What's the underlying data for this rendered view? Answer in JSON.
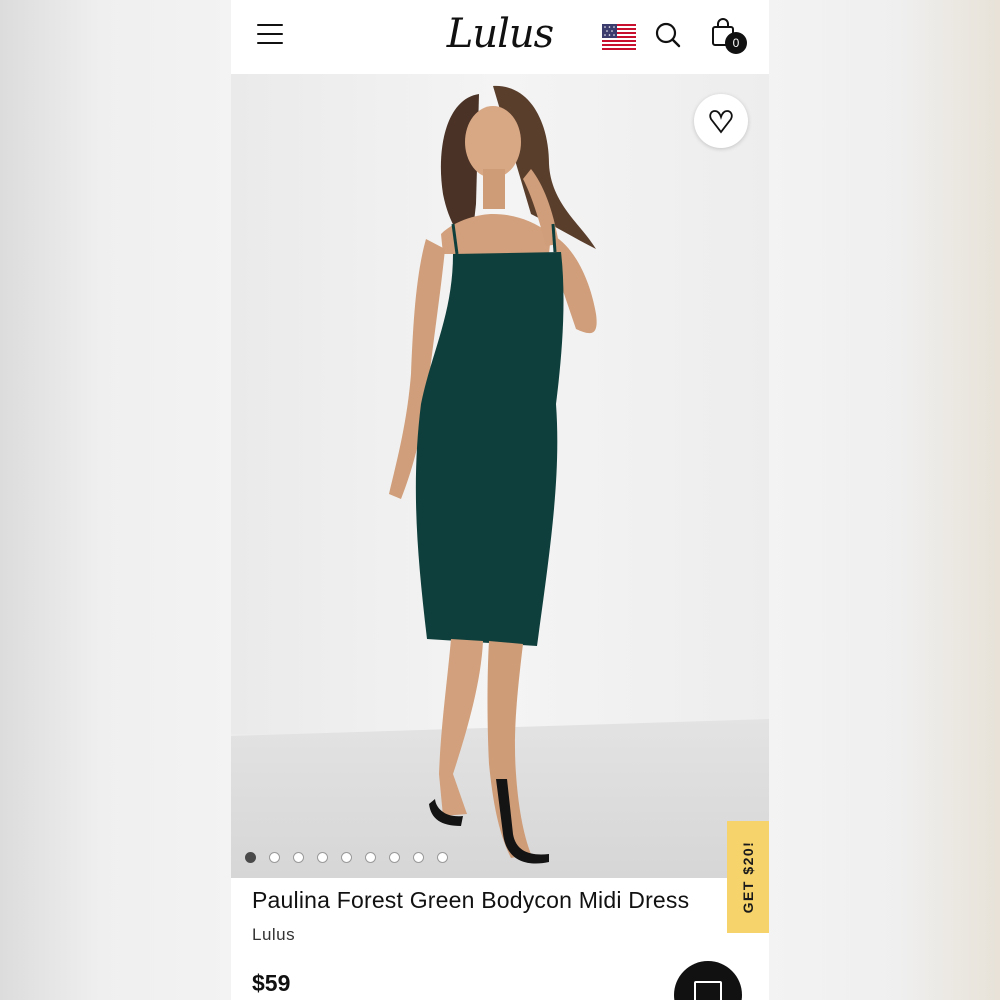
{
  "header": {
    "logo_text": "Lulus",
    "cart_count": "0",
    "icons": {
      "menu": "hamburger-menu-icon",
      "flag": "us-flag-icon",
      "search": "search-icon",
      "cart": "shopping-bag-icon"
    }
  },
  "gallery": {
    "total_images": 9,
    "active_index": 0,
    "wishlist_icon": "heart-outline-icon"
  },
  "promo": {
    "label": "GET $20!",
    "color": "#f6d36b"
  },
  "product": {
    "title": "Paulina Forest Green Bodycon Midi Dress",
    "brand": "Lulus",
    "price": "$59",
    "dress_color": "#0f3f3c"
  },
  "chat": {
    "icon": "chat-icon"
  }
}
